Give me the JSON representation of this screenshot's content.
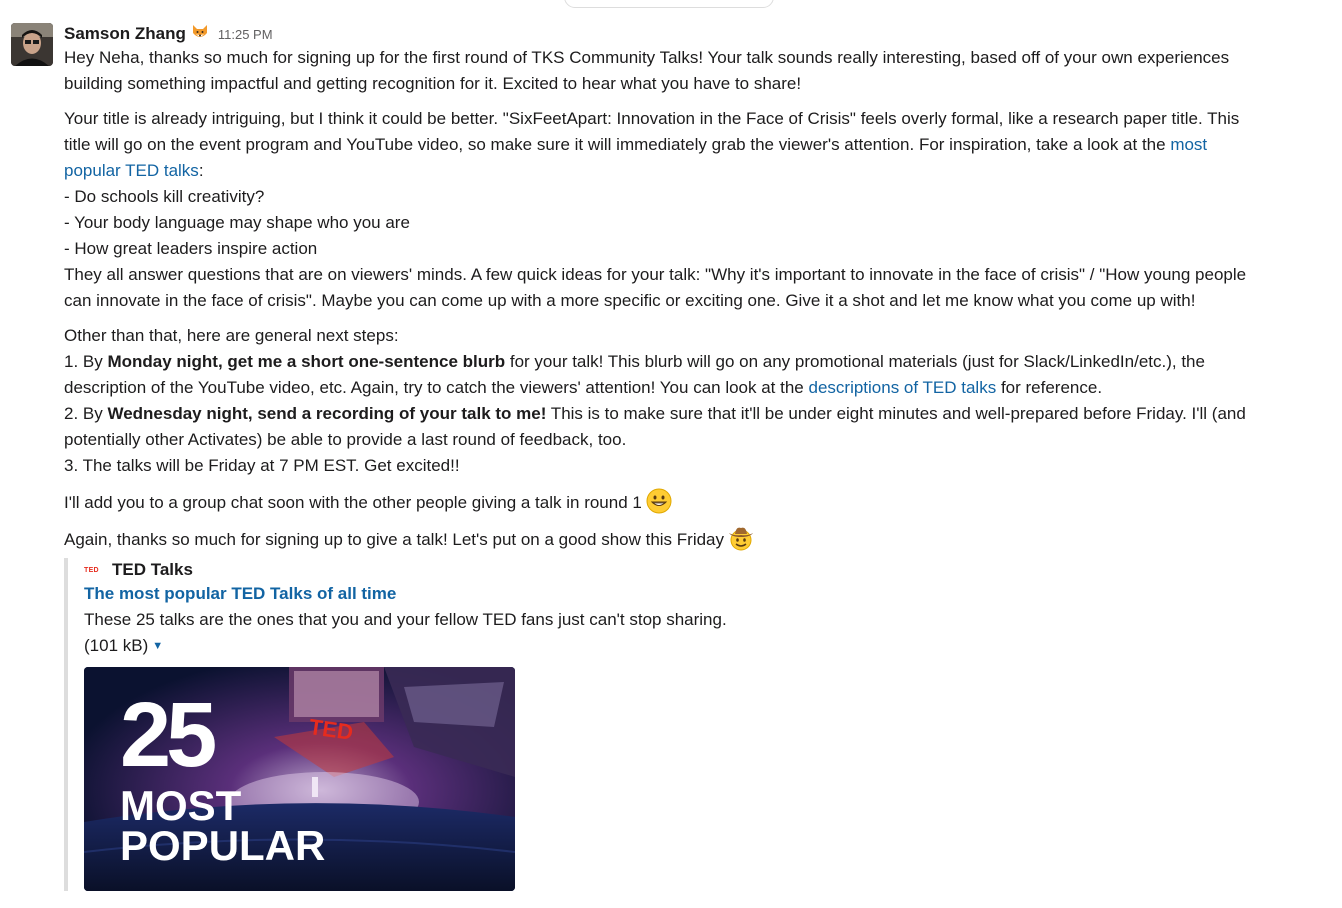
{
  "message": {
    "author": "Samson Zhang",
    "timestamp": "11:25 PM",
    "p1": "Hey Neha, thanks so much for signing up for the first round of TKS Community Talks! Your talk sounds really interesting, based off of your own experiences",
    "p1b": "building something impactful and getting recognition for it. Excited to hear what you have to share!",
    "p2a": "Your title is already intriguing, but I think it could be better. \"SixFeetApart: Innovation in the Face of Crisis\" feels overly formal, like a research paper title. This",
    "p2b": "title will go on the event program and YouTube video, so make sure it will immediately grab the viewer's attention. For inspiration, take a look at the ",
    "p2_link_a": "most",
    "p2_link_b": "popular TED talks",
    "p2c": ":",
    "bullet1": "- Do schools kill creativity?",
    "bullet2": "- Your body language may shape who you are",
    "bullet3": "- How great leaders inspire action",
    "p2d": "They all answer questions that are on viewers' minds. A few quick ideas for your talk: \"Why it's important to innovate in the face of crisis\" / \"How young people",
    "p2e": "can innovate in the face of crisis\". Maybe you can come up with a more specific or exciting one. Give it a shot and let me know what you come up with!",
    "p3": "Other than that, here are general next steps:",
    "s1_pre": "1. By ",
    "s1_bold": "Monday night, get me a short one-sentence blurb",
    "s1_post": " for your talk! This blurb will go on any promotional materials (just for Slack/LinkedIn/etc.), the",
    "s1b_pre": "description of the YouTube video, etc. Again, try to catch the viewers' attention! You can look at the ",
    "s1b_link": "descriptions of TED talks",
    "s1b_post": " for reference.",
    "s2_pre": "2. By ",
    "s2_bold": "Wednesday night, send a recording of your talk to me!",
    "s2_post": " This is to make sure that it'll be under eight minutes and well-prepared before Friday. I'll (and",
    "s2b": "potentially other Activates) be able to provide a last round of feedback, too.",
    "s3": "3. The talks will be Friday at 7 PM EST. Get excited!!",
    "p4": "I'll add you to a group chat soon with the other people giving a talk in round 1",
    "p5": "Again, thanks so much for signing up to give a talk! Let's put on a good show this Friday"
  },
  "attachment": {
    "service_icon_text": "TED",
    "service_name": "TED Talks",
    "title": "The most popular TED Talks of all time",
    "description": "These 25 talks are the ones that you and your fellow TED fans just can't stop sharing.",
    "size": "(101 kB)",
    "thumb_line1": "25",
    "thumb_line2": "MOST",
    "thumb_line3": "POPULAR",
    "thumb_stage_text": "TED"
  },
  "icons": {
    "status": "fox-face-icon",
    "p4_emoji": "grinning-face-icon",
    "p5_emoji": "cowboy-face-icon",
    "caret": "caret-down-icon"
  },
  "colors": {
    "link": "#1264a3",
    "ted_red": "#e62b1e",
    "text": "#1d1c1d",
    "muted": "#616061"
  }
}
